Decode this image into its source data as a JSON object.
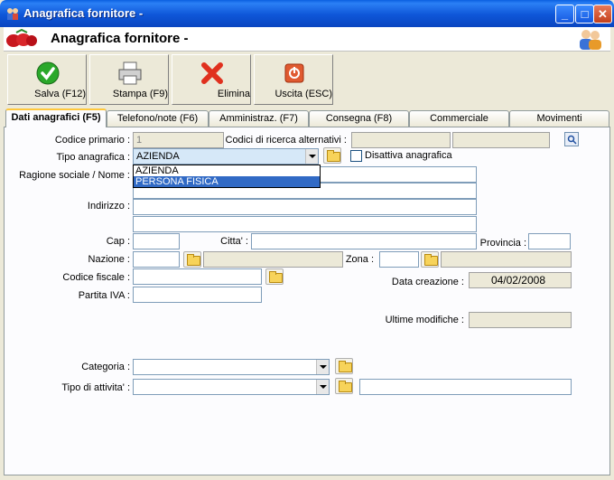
{
  "window": {
    "title": "Anagrafica fornitore -"
  },
  "header": {
    "title": "Anagrafica fornitore -"
  },
  "toolbar": {
    "save": "Salva (F12)",
    "print": "Stampa (F9)",
    "delete": "Elimina",
    "exit": "Uscita (ESC)"
  },
  "tabs": [
    "Dati anagrafici (F5)",
    "Telefono/note (F6)",
    "Amministraz. (F7)",
    "Consegna (F8)",
    "Commerciale",
    "Movimenti"
  ],
  "form": {
    "codice_primario_label": "Codice primario :",
    "codice_primario_value": "1",
    "codici_ricerca_label": "Codici di ricerca alternativi :",
    "tipo_anagrafica_label": "Tipo anagrafica :",
    "tipo_anagrafica_value": "AZIENDA",
    "disattiva_label": "Disattiva anagrafica",
    "ragione_sociale_label": "Ragione sociale / Nome :",
    "indirizzo_label": "Indirizzo :",
    "cap_label": "Cap :",
    "citta_label": "Citta' :",
    "provincia_label": "Provincia :",
    "nazione_label": "Nazione :",
    "zona_label": "Zona :",
    "codice_fiscale_label": "Codice fiscale :",
    "data_creazione_label": "Data creazione :",
    "data_creazione_value": "04/02/2008",
    "partita_iva_label": "Partita IVA :",
    "ultime_modifiche_label": "Ultime modifiche :",
    "categoria_label": "Categoria :",
    "tipo_attivita_label": "Tipo di attivita' :"
  },
  "dropdown": {
    "options": [
      "AZIENDA",
      "PERSONA FISICA"
    ],
    "highlighted": "PERSONA FISICA"
  }
}
